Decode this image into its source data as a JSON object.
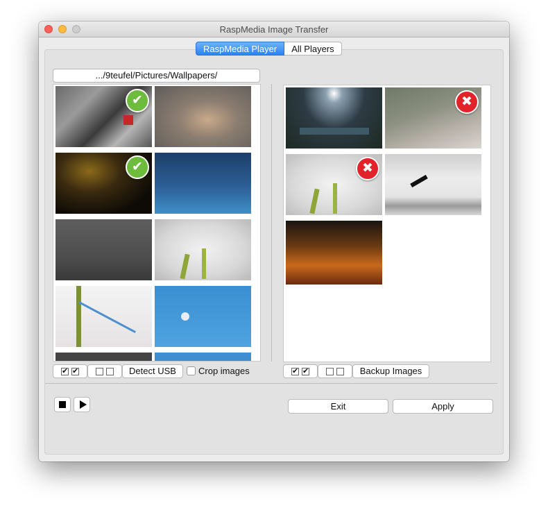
{
  "window": {
    "title": "RaspMedia Image Transfer"
  },
  "tabs": [
    {
      "label": "RaspMedia Player",
      "active": true
    },
    {
      "label": "All Players",
      "active": false
    }
  ],
  "left_panel": {
    "path": ".../9teufel/Pictures/Wallpapers/",
    "images": [
      {
        "subject": "bicycle street",
        "status": "selected"
      },
      {
        "subject": "bokeh lights",
        "status": "none"
      },
      {
        "subject": "concert stage",
        "status": "selected"
      },
      {
        "subject": "starry blue sky",
        "status": "none"
      },
      {
        "subject": "foggy bridge",
        "status": "none"
      },
      {
        "subject": "dragonfly flower",
        "status": "none"
      },
      {
        "subject": "dragonfly stem",
        "status": "none"
      },
      {
        "subject": "moon blue sky",
        "status": "none"
      },
      {
        "subject": "partial dark image",
        "status": "none"
      },
      {
        "subject": "partial blue image",
        "status": "none"
      }
    ],
    "toolbar": {
      "select_all_glyph": "✔",
      "detect_usb_label": "Detect USB",
      "crop_images_label": "Crop images",
      "crop_images_checked": false
    }
  },
  "right_panel": {
    "images": [
      {
        "subject": "night pond moon",
        "status": "none"
      },
      {
        "subject": "volcano slope",
        "status": "delete"
      },
      {
        "subject": "dragonfly flower",
        "status": "delete"
      },
      {
        "subject": "bird flying",
        "status": "none"
      },
      {
        "subject": "night street lights",
        "status": "none"
      }
    ],
    "toolbar": {
      "select_all_glyph": "✔",
      "backup_label": "Backup Images"
    }
  },
  "badges": {
    "ok_glyph": "✔",
    "bad_glyph": "✖"
  },
  "footer": {
    "exit_label": "Exit",
    "apply_label": "Apply"
  }
}
